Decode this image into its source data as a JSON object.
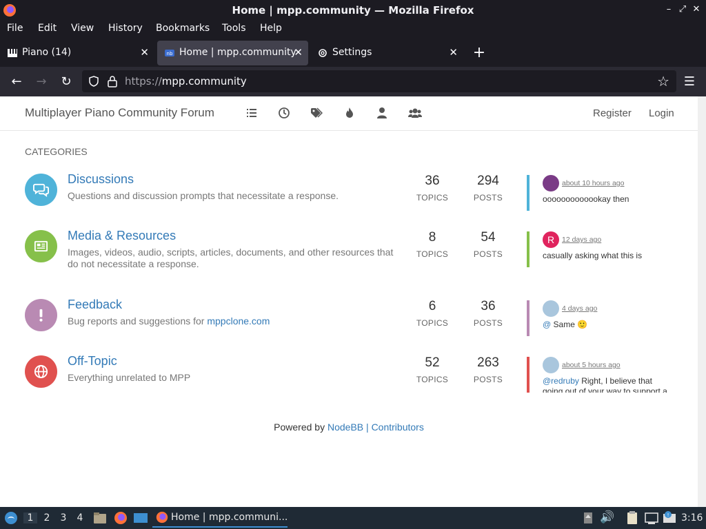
{
  "window": {
    "title": "Home | mpp.community — Mozilla Firefox"
  },
  "menubar": {
    "items": [
      "File",
      "Edit",
      "View",
      "History",
      "Bookmarks",
      "Tools",
      "Help"
    ]
  },
  "tabs": [
    {
      "label": "Piano (14)",
      "active": false
    },
    {
      "label": "Home | mpp.community",
      "active": true
    },
    {
      "label": "Settings",
      "active": false
    }
  ],
  "urlbar": {
    "scheme": "https://",
    "host": "mpp.community"
  },
  "site": {
    "brand": "Multiplayer Piano Community Forum",
    "nav_icons": [
      "list-icon",
      "clock-icon",
      "tags-icon",
      "fire-icon",
      "user-icon",
      "users-icon"
    ],
    "register": "Register",
    "login": "Login",
    "categories_heading": "CATEGORIES",
    "topics_label": "TOPICS",
    "posts_label": "POSTS"
  },
  "categories": [
    {
      "name": "Discussions",
      "description": "Questions and discussion prompts that necessitate a response.",
      "topics": "36",
      "posts": "294",
      "color": "#4fb3d9",
      "icon": "comments-icon",
      "last_post": {
        "time": "about 10 hours ago",
        "text": "ooooooooooookay then",
        "mention": ""
      }
    },
    {
      "name": "Media & Resources",
      "description": "Images, videos, audio, scripts, articles, documents, and other resources that do not necessitate a response.",
      "topics": "8",
      "posts": "54",
      "color": "#86c04a",
      "icon": "newspaper-icon",
      "last_post": {
        "time": "12 days ago",
        "text": "casually asking what this is",
        "mention": "",
        "avatar_letter": "R"
      }
    },
    {
      "name": "Feedback",
      "description": "Bug reports and suggestions for ",
      "description_link": "mppclone.com",
      "topics": "6",
      "posts": "36",
      "color": "#b98ab3",
      "icon": "exclamation-icon",
      "last_post": {
        "time": "4 days ago",
        "text": " Same 🙂",
        "mention": "@"
      }
    },
    {
      "name": "Off-Topic",
      "description": "Everything unrelated to MPP",
      "topics": "52",
      "posts": "263",
      "color": "#e0514f",
      "icon": "globe-icon",
      "last_post": {
        "time": "about 5 hours ago",
        "text": " Right, I believe that going out of your way to support a specific app and ...",
        "mention": "@redruby"
      }
    }
  ],
  "footer": {
    "prefix": "Powered by ",
    "nodebb": "NodeBB",
    "sep": " | ",
    "contributors": "Contributors"
  },
  "taskbar": {
    "workspaces": [
      "1",
      "2",
      "3",
      "4"
    ],
    "task_label": "Home | mpp.communi...",
    "clock": "3:16"
  }
}
